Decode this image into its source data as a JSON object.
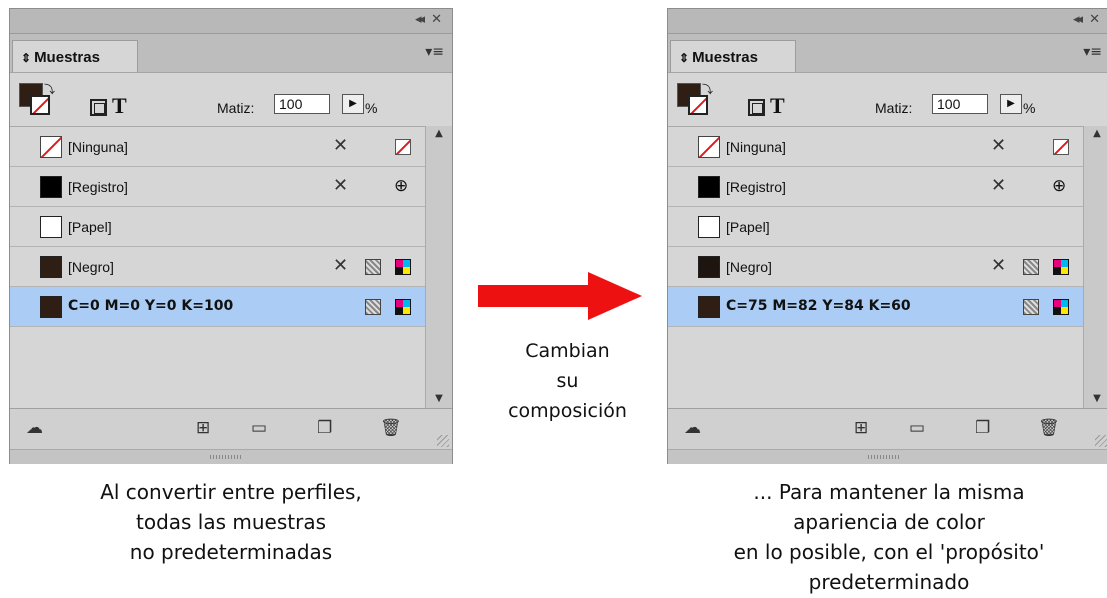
{
  "panel_left": {
    "title_icons": {
      "collapse": "double-chevron-left-icon",
      "close": "close-icon"
    },
    "tab_label": "Muestras",
    "tint_label": "Matiz:",
    "tint_value": "100",
    "tint_unit": "%",
    "swatches": [
      {
        "label": "[Ninguna]",
        "kind": "none",
        "color": ""
      },
      {
        "label": "[Registro]",
        "kind": "solid",
        "color": "#000000"
      },
      {
        "label": "[Papel]",
        "kind": "white",
        "color": "#ffffff"
      },
      {
        "label": "[Negro]",
        "kind": "solid",
        "color": "#2e1e14"
      },
      {
        "label": "C=0 M=0 Y=0 K=100",
        "kind": "solid",
        "color": "#2e1e14",
        "selected": true
      }
    ]
  },
  "panel_right": {
    "title_icons": {
      "collapse": "double-chevron-left-icon",
      "close": "close-icon"
    },
    "tab_label": "Muestras",
    "tint_label": "Matiz:",
    "tint_value": "100",
    "tint_unit": "%",
    "swatches": [
      {
        "label": "[Ninguna]",
        "kind": "none",
        "color": ""
      },
      {
        "label": "[Registro]",
        "kind": "solid",
        "color": "#000000"
      },
      {
        "label": "[Papel]",
        "kind": "white",
        "color": "#ffffff"
      },
      {
        "label": "[Negro]",
        "kind": "solid",
        "color": "#1e1410"
      },
      {
        "label": "C=75 M=82 Y=84 K=60",
        "kind": "solid",
        "color": "#2e1e14",
        "selected": true
      }
    ]
  },
  "arrow": {
    "line1": "Cambian",
    "line2": "su",
    "line3": "composición",
    "color": "#ee1111"
  },
  "caption_left": {
    "line1": "Al convertir entre perfiles,",
    "line2": "todas las muestras",
    "line3": "no predeterminadas"
  },
  "caption_right": {
    "line1": "... Para mantener la misma",
    "line2": "apariencia de color",
    "line3": "en lo posible, con el 'propósito'",
    "line4": "predeterminado"
  },
  "colors": {
    "selected_row": "#abcdf5",
    "panel_bg": "#d6d6d6"
  }
}
